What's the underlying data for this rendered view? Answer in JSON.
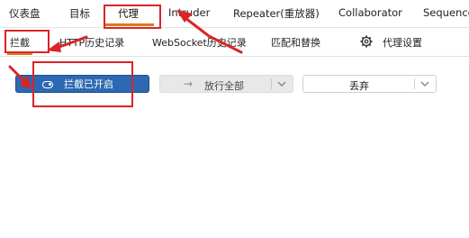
{
  "top_tabs": [
    {
      "label": "仪表盘"
    },
    {
      "label": "目标"
    },
    {
      "label": "代理"
    },
    {
      "label": "Intruder"
    },
    {
      "label": "Repeater(重放器)"
    },
    {
      "label": "Collaborator"
    },
    {
      "label": "Sequencer"
    }
  ],
  "sub_tabs": [
    {
      "label": "拦截"
    },
    {
      "label": "HTTP历史记录"
    },
    {
      "label": "WebSocket历史记录"
    },
    {
      "label": "匹配和替换"
    },
    {
      "label": "代理设置"
    }
  ],
  "toolbar": {
    "intercept_label": "拦截已开启",
    "forward_label": "放行全部",
    "drop_label": "丢弃"
  },
  "colors": {
    "accent": "#e0781f",
    "primary_button": "#2e68b2",
    "annotation_red": "#d92525"
  },
  "icons": [
    "gear-icon",
    "toggle-icon",
    "arrow-right-icon",
    "chevron-down-icon"
  ]
}
